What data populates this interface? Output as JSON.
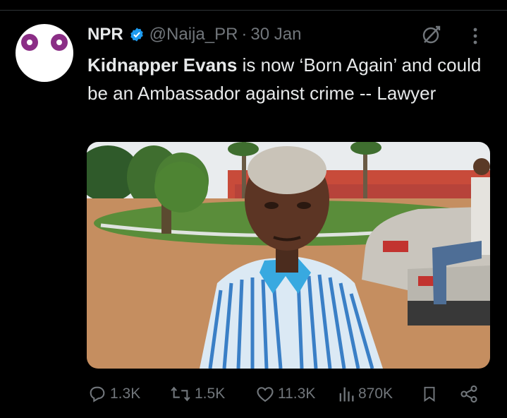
{
  "post": {
    "author_name": "NPR",
    "handle": "@Naija_PR",
    "separator": "·",
    "date": "30 Jan",
    "text_bold": "Kidnapper Evans",
    "text_rest": " is now ‘Born Again’ and could be an Ambassador against crime -- Lawyer"
  },
  "stats": {
    "replies": "1.3K",
    "reposts": "1.5K",
    "likes": "11.3K",
    "views": "870K"
  },
  "colors": {
    "background": "#000000",
    "text": "#e7e9ea",
    "muted": "#71767b",
    "verified_badge": "#1d9bf0",
    "avatar_eyes": "#8b2e86"
  },
  "icons": [
    "verified-badge-icon",
    "grok-icon",
    "more-icon",
    "reply-icon",
    "repost-icon",
    "like-icon",
    "views-icon",
    "bookmark-icon",
    "share-icon"
  ]
}
